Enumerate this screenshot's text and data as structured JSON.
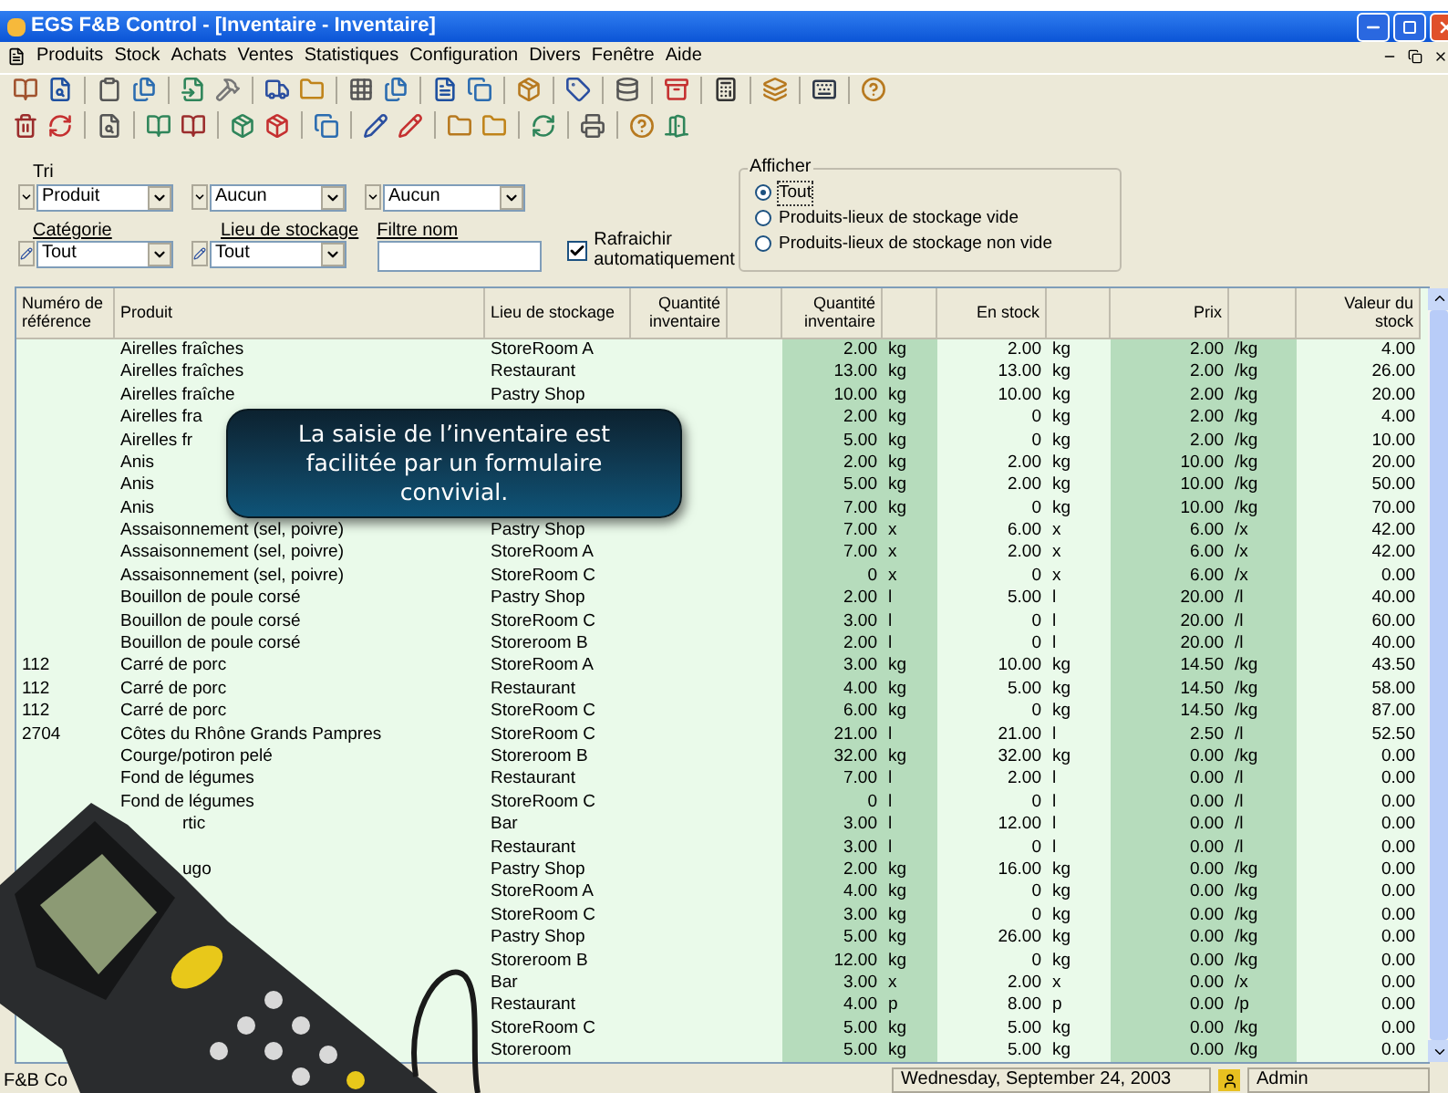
{
  "window": {
    "title": "EGS F&B Control - [Inventaire - Inventaire]"
  },
  "menu": [
    "Produits",
    "Stock",
    "Achats",
    "Ventes",
    "Statistiques",
    "Configuration",
    "Divers",
    "Fenêtre",
    "Aide"
  ],
  "filters": {
    "sort": {
      "label": "Tri",
      "fields": [
        "Produit",
        "Aucun",
        "Aucun"
      ]
    },
    "category": {
      "label": "Catégorie",
      "value": "Tout"
    },
    "location": {
      "label": "Lieu de stockage",
      "value": "Tout"
    },
    "name_filter": {
      "label": "Filtre nom"
    },
    "auto_refresh": {
      "label": "Rafraichir automatiquement",
      "checked": true
    },
    "display": {
      "label": "Afficher",
      "options": [
        {
          "label": "Tout",
          "selected": true
        },
        {
          "label": "Produits-lieux de stockage vide",
          "selected": false
        },
        {
          "label": "Produits-lieux de stockage non vide",
          "selected": false
        }
      ]
    }
  },
  "table": {
    "columns": [
      {
        "label": "Numéro de référence",
        "shaded": false
      },
      {
        "label": "Produit",
        "shaded": false
      },
      {
        "label": "Lieu de stockage",
        "shaded": false
      },
      {
        "label": "Quantité inventaire",
        "shaded": false
      },
      {
        "shaded": false
      },
      {
        "label": "Quantité inventaire",
        "shaded": true
      },
      {
        "shaded": true
      },
      {
        "label": "En stock",
        "shaded": false
      },
      {
        "shaded": false
      },
      {
        "label": "Prix",
        "shaded": true
      },
      {
        "shaded": true
      },
      {
        "label": "Valeur du stock",
        "shaded": false
      }
    ],
    "rows": [
      {
        "product": "Airelles fraîches",
        "location": "StoreRoom A",
        "qty": "2.00",
        "qty_unit": "kg",
        "stock": "2.00",
        "stock_unit": "kg",
        "price": "2.00",
        "price_unit": "/kg",
        "value": "4.00"
      },
      {
        "product": "Airelles fraîches",
        "location": "Restaurant",
        "qty": "13.00",
        "qty_unit": "kg",
        "stock": "13.00",
        "stock_unit": "kg",
        "price": "2.00",
        "price_unit": "/kg",
        "value": "26.00"
      },
      {
        "product": "Airelles fraîche",
        "location": "Pastry Shop",
        "qty": "10.00",
        "qty_unit": "kg",
        "stock": "10.00",
        "stock_unit": "kg",
        "price": "2.00",
        "price_unit": "/kg",
        "value": "20.00"
      },
      {
        "product": "Airelles fra",
        "qty": "2.00",
        "qty_unit": "kg",
        "stock": "0",
        "stock_unit": "kg",
        "price": "2.00",
        "price_unit": "/kg",
        "value": "4.00"
      },
      {
        "product": "Airelles fr",
        "qty": "5.00",
        "qty_unit": "kg",
        "stock": "0",
        "stock_unit": "kg",
        "price": "2.00",
        "price_unit": "/kg",
        "value": "10.00"
      },
      {
        "product": "Anis",
        "qty": "2.00",
        "qty_unit": "kg",
        "stock": "2.00",
        "stock_unit": "kg",
        "price": "10.00",
        "price_unit": "/kg",
        "value": "20.00"
      },
      {
        "product": "Anis",
        "qty": "5.00",
        "qty_unit": "kg",
        "stock": "2.00",
        "stock_unit": "kg",
        "price": "10.00",
        "price_unit": "/kg",
        "value": "50.00"
      },
      {
        "product": "Anis",
        "qty": "7.00",
        "qty_unit": "kg",
        "stock": "0",
        "stock_unit": "kg",
        "price": "10.00",
        "price_unit": "/kg",
        "value": "70.00"
      },
      {
        "product": "Assaisonnement (sel, poivre)",
        "location": "Pastry Shop",
        "qty": "7.00",
        "qty_unit": "x",
        "stock": "6.00",
        "stock_unit": "x",
        "price": "6.00",
        "price_unit": "/x",
        "value": "42.00"
      },
      {
        "product": "Assaisonnement (sel, poivre)",
        "location": "StoreRoom A",
        "qty": "7.00",
        "qty_unit": "x",
        "stock": "2.00",
        "stock_unit": "x",
        "price": "6.00",
        "price_unit": "/x",
        "value": "42.00"
      },
      {
        "product": "Assaisonnement (sel, poivre)",
        "location": "StoreRoom C",
        "qty": "0",
        "qty_unit": "x",
        "stock": "0",
        "stock_unit": "x",
        "price": "6.00",
        "price_unit": "/x",
        "value": "0.00"
      },
      {
        "product": "Bouillon de poule corsé",
        "location": "Pastry Shop",
        "qty": "2.00",
        "qty_unit": "l",
        "stock": "5.00",
        "stock_unit": "l",
        "price": "20.00",
        "price_unit": "/l",
        "value": "40.00"
      },
      {
        "product": "Bouillon de poule corsé",
        "location": "StoreRoom C",
        "qty": "3.00",
        "qty_unit": "l",
        "stock": "0",
        "stock_unit": "l",
        "price": "20.00",
        "price_unit": "/l",
        "value": "60.00"
      },
      {
        "product": "Bouillon de poule corsé",
        "location": "Storeroom B",
        "qty": "2.00",
        "qty_unit": "l",
        "stock": "0",
        "stock_unit": "l",
        "price": "20.00",
        "price_unit": "/l",
        "value": "40.00"
      },
      {
        "ref": "112",
        "product": "Carré de porc",
        "location": "StoreRoom A",
        "qty": "3.00",
        "qty_unit": "kg",
        "stock": "10.00",
        "stock_unit": "kg",
        "price": "14.50",
        "price_unit": "/kg",
        "value": "43.50"
      },
      {
        "ref": "112",
        "product": "Carré de porc",
        "location": "Restaurant",
        "qty": "4.00",
        "qty_unit": "kg",
        "stock": "5.00",
        "stock_unit": "kg",
        "price": "14.50",
        "price_unit": "/kg",
        "value": "58.00"
      },
      {
        "ref": "112",
        "product": "Carré de porc",
        "location": "StoreRoom C",
        "qty": "6.00",
        "qty_unit": "kg",
        "stock": "0",
        "stock_unit": "kg",
        "price": "14.50",
        "price_unit": "/kg",
        "value": "87.00"
      },
      {
        "ref": "2704",
        "product": "Côtes du Rhône Grands Pampres",
        "location": "StoreRoom C",
        "qty": "21.00",
        "qty_unit": "l",
        "stock": "21.00",
        "stock_unit": "l",
        "price": "2.50",
        "price_unit": "/l",
        "value": "52.50"
      },
      {
        "product": "Courge/potiron pelé",
        "location": "Storeroom B",
        "qty": "32.00",
        "qty_unit": "kg",
        "stock": "32.00",
        "stock_unit": "kg",
        "price": "0.00",
        "price_unit": "/kg",
        "value": "0.00"
      },
      {
        "product": "Fond de légumes",
        "location": "Restaurant",
        "qty": "7.00",
        "qty_unit": "l",
        "stock": "2.00",
        "stock_unit": "l",
        "price": "0.00",
        "price_unit": "/l",
        "value": "0.00"
      },
      {
        "product": "Fond de légumes",
        "location": "StoreRoom C",
        "qty": "0",
        "qty_unit": "l",
        "stock": "0",
        "stock_unit": "l",
        "price": "0.00",
        "price_unit": "/l",
        "value": "0.00"
      },
      {
        "product_tail": "rtic",
        "location": "Bar",
        "qty": "3.00",
        "qty_unit": "l",
        "stock": "12.00",
        "stock_unit": "l",
        "price": "0.00",
        "price_unit": "/l",
        "value": "0.00"
      },
      {
        "location": "Restaurant",
        "qty": "3.00",
        "qty_unit": "l",
        "stock": "0",
        "stock_unit": "l",
        "price": "0.00",
        "price_unit": "/l",
        "value": "0.00"
      },
      {
        "product_tail": "ugo",
        "location": "Pastry Shop",
        "qty": "2.00",
        "qty_unit": "kg",
        "stock": "16.00",
        "stock_unit": "kg",
        "price": "0.00",
        "price_unit": "/kg",
        "value": "0.00"
      },
      {
        "location": "StoreRoom A",
        "qty": "4.00",
        "qty_unit": "kg",
        "stock": "0",
        "stock_unit": "kg",
        "price": "0.00",
        "price_unit": "/kg",
        "value": "0.00"
      },
      {
        "location": "StoreRoom C",
        "qty": "3.00",
        "qty_unit": "kg",
        "stock": "0",
        "stock_unit": "kg",
        "price": "0.00",
        "price_unit": "/kg",
        "value": "0.00"
      },
      {
        "location": "Pastry Shop",
        "qty": "5.00",
        "qty_unit": "kg",
        "stock": "26.00",
        "stock_unit": "kg",
        "price": "0.00",
        "price_unit": "/kg",
        "value": "0.00"
      },
      {
        "location": "Storeroom B",
        "qty": "12.00",
        "qty_unit": "kg",
        "stock": "0",
        "stock_unit": "kg",
        "price": "0.00",
        "price_unit": "/kg",
        "value": "0.00"
      },
      {
        "location": "Bar",
        "qty": "3.00",
        "qty_unit": "x",
        "stock": "2.00",
        "stock_unit": "x",
        "price": "0.00",
        "price_unit": "/x",
        "value": "0.00"
      },
      {
        "location": "Restaurant",
        "qty": "4.00",
        "qty_unit": "p",
        "stock": "8.00",
        "stock_unit": "p",
        "price": "0.00",
        "price_unit": "/p",
        "value": "0.00"
      },
      {
        "location": "StoreRoom C",
        "qty": "5.00",
        "qty_unit": "kg",
        "stock": "5.00",
        "stock_unit": "kg",
        "price": "0.00",
        "price_unit": "/kg",
        "value": "0.00"
      },
      {
        "location": "Storeroom",
        "qty": "5.00",
        "qty_unit": "kg",
        "stock": "5.00",
        "stock_unit": "kg",
        "price": "0.00",
        "price_unit": "/kg",
        "value": "0.00"
      }
    ]
  },
  "callout": {
    "text": "La saisie de l’inventaire est facilitée par un formulaire convivial."
  },
  "status_bar": {
    "app": "F&B Co",
    "date": "Wednesday, September 24, 2003",
    "user": "Admin"
  }
}
